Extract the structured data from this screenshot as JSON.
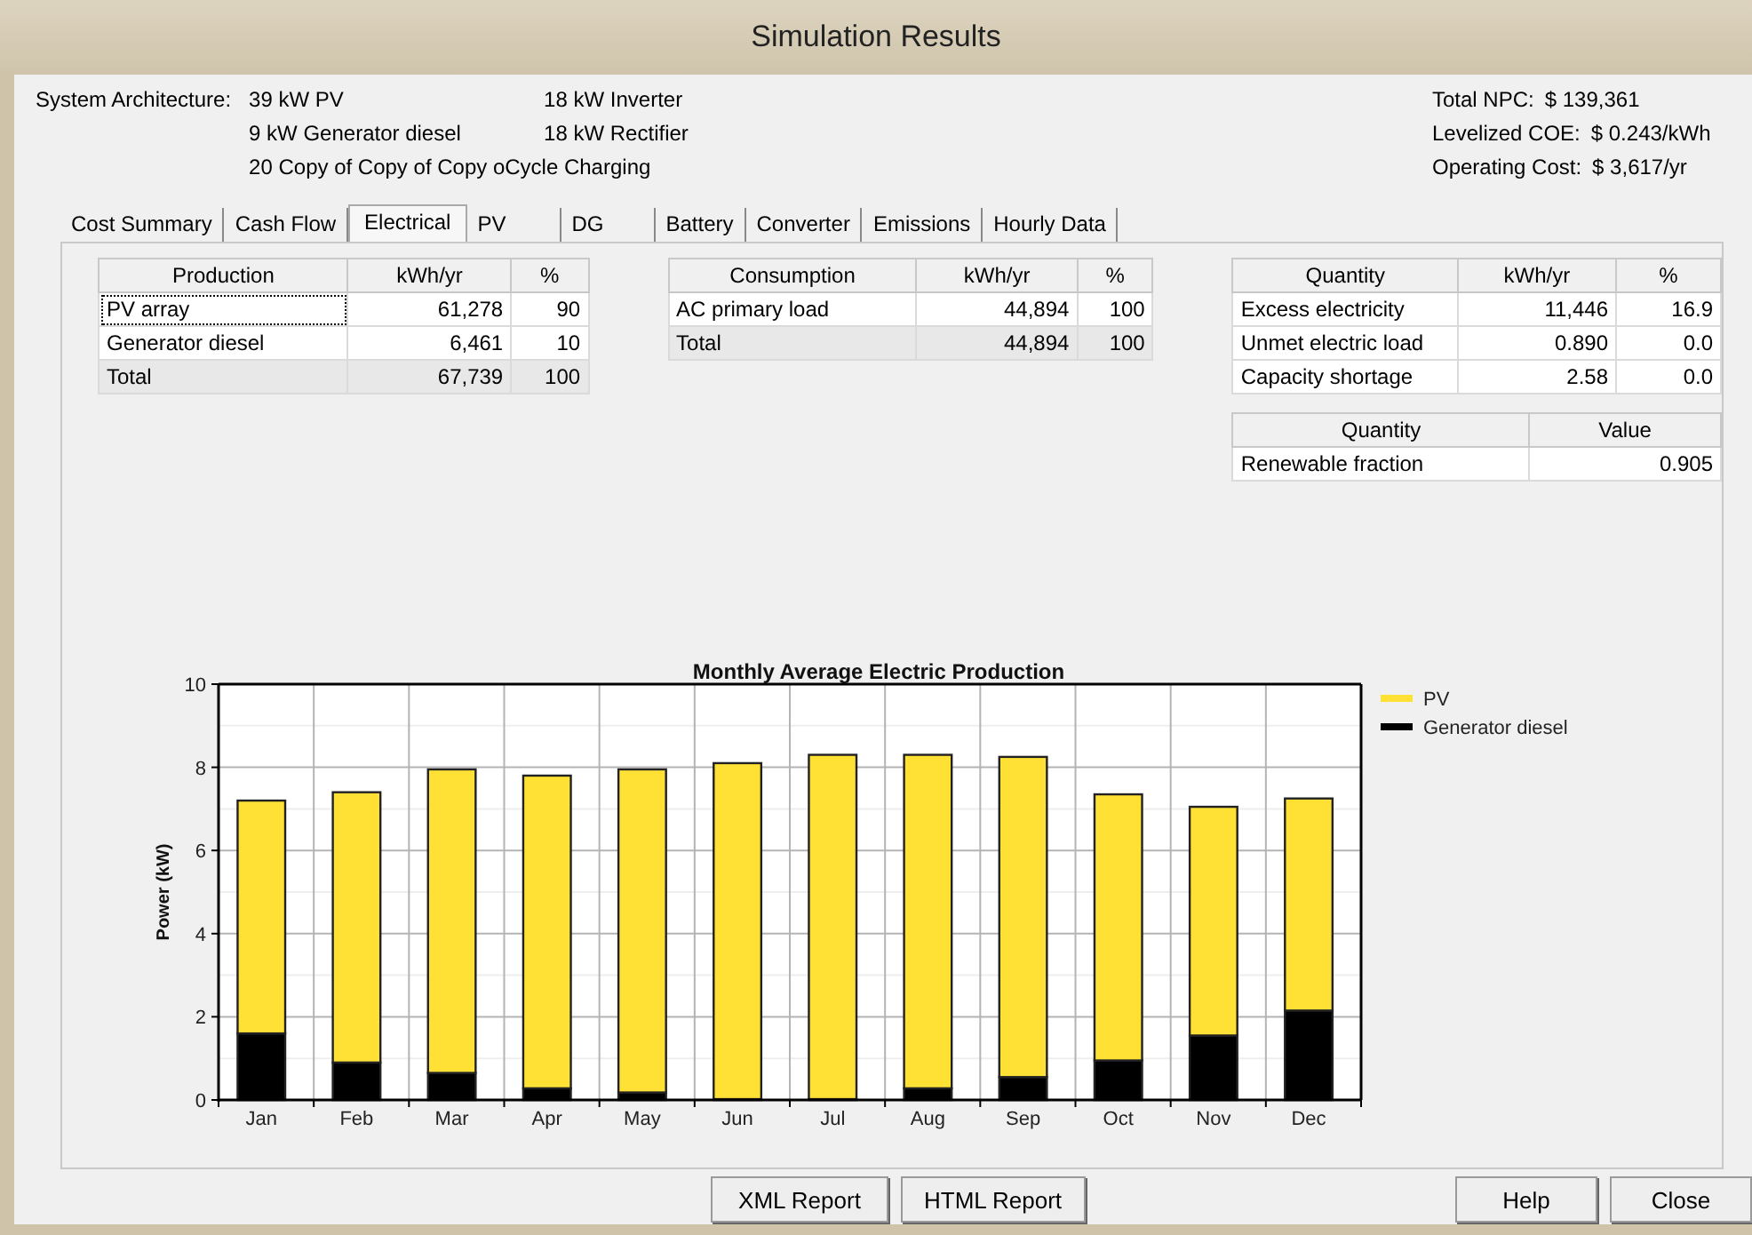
{
  "window": {
    "title": "Simulation Results"
  },
  "architecture": {
    "label": "System Architecture:",
    "columns": [
      [
        "39 kW PV",
        "9 kW Generator diesel",
        "20 Copy of Copy of Copy oCycle Charging"
      ],
      [
        "18 kW Inverter",
        "18 kW Rectifier"
      ]
    ]
  },
  "summary": [
    {
      "label": "Total NPC:",
      "value": "$ 139,361"
    },
    {
      "label": "Levelized COE:",
      "value": "$ 0.243/kWh"
    },
    {
      "label": "Operating Cost:",
      "value": "$ 3,617/yr"
    }
  ],
  "tabs": [
    {
      "label": "Cost Summary",
      "selected": false
    },
    {
      "label": "Cash Flow",
      "selected": false
    },
    {
      "label": "Electrical",
      "selected": true
    },
    {
      "label": "PV",
      "selected": false
    },
    {
      "label": "DG",
      "selected": false
    },
    {
      "label": "Battery",
      "selected": false
    },
    {
      "label": "Converter",
      "selected": false
    },
    {
      "label": "Emissions",
      "selected": false
    },
    {
      "label": "Hourly Data",
      "selected": false
    }
  ],
  "tables": [
    {
      "columns": [
        "Production",
        "kWh/yr",
        "%"
      ],
      "rows": [
        {
          "cells": [
            "PV array",
            "61,278",
            "90"
          ],
          "total": false,
          "focused": true
        },
        {
          "cells": [
            "Generator diesel",
            "6,461",
            "10"
          ],
          "total": false,
          "focused": false
        },
        {
          "cells": [
            "Total",
            "67,739",
            "100"
          ],
          "total": true,
          "focused": false
        }
      ]
    },
    {
      "columns": [
        "Consumption",
        "kWh/yr",
        "%"
      ],
      "rows": [
        {
          "cells": [
            "AC primary load",
            "44,894",
            "100"
          ],
          "total": false,
          "focused": false
        },
        {
          "cells": [
            "Total",
            "44,894",
            "100"
          ],
          "total": true,
          "focused": false
        }
      ]
    },
    {
      "columns": [
        "Quantity",
        "kWh/yr",
        "%"
      ],
      "rows": [
        {
          "cells": [
            "Excess electricity",
            "11,446",
            "16.9"
          ],
          "total": false,
          "focused": false
        },
        {
          "cells": [
            "Unmet electric load",
            "0.890",
            "0.0"
          ],
          "total": false,
          "focused": false
        },
        {
          "cells": [
            "Capacity shortage",
            "2.58",
            "0.0"
          ],
          "total": false,
          "focused": false
        }
      ]
    },
    {
      "columns": [
        "Quantity",
        "Value"
      ],
      "rows": [
        {
          "cells": [
            "Renewable fraction",
            "0.905"
          ],
          "total": false,
          "focused": false
        }
      ]
    }
  ],
  "chart": {
    "chart_data": {
      "type": "bar",
      "title": "Monthly Average Electric Production",
      "ylabel": "Power (kW)",
      "stacked": true,
      "categories": [
        "Jan",
        "Feb",
        "Mar",
        "Apr",
        "May",
        "Jun",
        "Jul",
        "Aug",
        "Sep",
        "Oct",
        "Nov",
        "Dec"
      ],
      "ylim": [
        0,
        10
      ],
      "yticks": [
        0,
        2,
        4,
        6,
        8,
        {
          "value": 10,
          "label": "10"
        }
      ],
      "grid": true,
      "legend": true,
      "series": [
        {
          "name": "PV",
          "color": "#ffe135",
          "values": [
            5.6,
            6.5,
            7.3,
            7.52,
            7.77,
            8.08,
            8.28,
            8.02,
            7.7,
            6.4,
            5.5,
            5.1
          ]
        },
        {
          "name": "Generator diesel",
          "color": "#000000",
          "values": [
            1.6,
            0.9,
            0.65,
            0.28,
            0.18,
            0.02,
            0.02,
            0.28,
            0.55,
            0.95,
            1.55,
            2.15
          ]
        }
      ]
    }
  },
  "report_buttons": [
    "XML Report",
    "HTML Report"
  ],
  "dialog_buttons": [
    "Help",
    "Close"
  ]
}
